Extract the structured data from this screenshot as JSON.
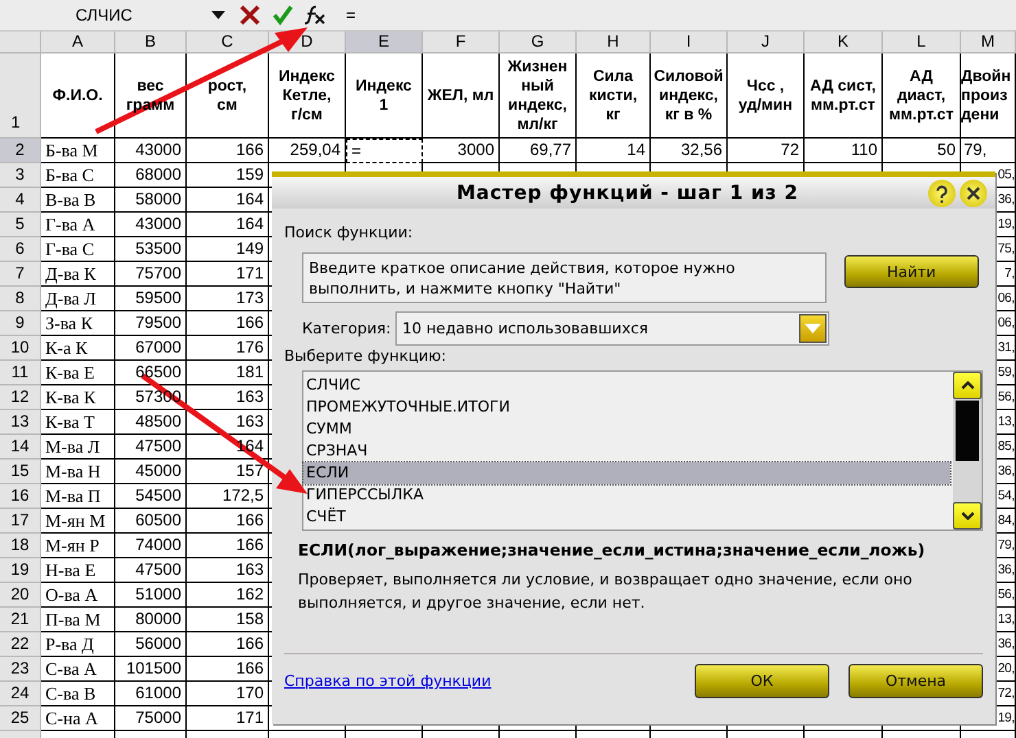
{
  "formula_bar": {
    "name_box": "СЛЧИС",
    "formula": "="
  },
  "sheet": {
    "columns": [
      {
        "letter": "A",
        "kind": "name",
        "selected": false
      },
      {
        "letter": "B",
        "kind": "number",
        "selected": false
      },
      {
        "letter": "C",
        "kind": "number",
        "selected": false
      },
      {
        "letter": "D",
        "kind": "number",
        "selected": false
      },
      {
        "letter": "E",
        "kind": "number",
        "selected": true
      },
      {
        "letter": "F",
        "kind": "number",
        "selected": false
      },
      {
        "letter": "G",
        "kind": "number",
        "selected": false
      },
      {
        "letter": "H",
        "kind": "number",
        "selected": false
      },
      {
        "letter": "I",
        "kind": "number",
        "selected": false
      },
      {
        "letter": "J",
        "kind": "number",
        "selected": false
      },
      {
        "letter": "K",
        "kind": "number",
        "selected": false
      },
      {
        "letter": "L",
        "kind": "number",
        "selected": false
      },
      {
        "letter": "M",
        "kind": "cut",
        "selected": false
      }
    ],
    "header_row": {
      "number": "1",
      "cells": [
        "Ф.И.О.",
        "вес\nграмм",
        "рост,\nсм",
        "Индекс\nКетле,\nг/см",
        "Индекс\n1",
        "ЖЕЛ, мл",
        "Жизнен\nный\nиндекс,\nмл/кг",
        "Сила\nкисти,\nкг",
        "Силовой\nиндекс,\nкг в %",
        "Чсс ,\nуд/мин",
        "АД сист,\nмм.рт.ст",
        "АД\nдиаст,\nмм.рт.ст",
        "Двойн\nпроиз\nдени"
      ]
    },
    "rows": [
      {
        "number": "2",
        "selected": true,
        "cells": [
          "Б-ва М",
          "43000",
          "166",
          "259,04",
          "=",
          "3000",
          "69,77",
          "14",
          "32,56",
          "72",
          "110",
          "50",
          "79,"
        ]
      },
      {
        "number": "3",
        "selected": false,
        "cells": [
          "Б-ва С",
          "68000",
          "159"
        ],
        "column_m": "05,"
      },
      {
        "number": "4",
        "selected": false,
        "cells": [
          "В-ва В",
          "58000",
          "164"
        ],
        "column_m": "36,"
      },
      {
        "number": "5",
        "selected": false,
        "cells": [
          "Г-ва А",
          "43000",
          "164"
        ],
        "column_m": "19,"
      },
      {
        "number": "6",
        "selected": false,
        "cells": [
          "Г-ва С",
          "53500",
          "149"
        ],
        "column_m": "75,"
      },
      {
        "number": "7",
        "selected": false,
        "cells": [
          "Д-ва К",
          "75700",
          "171"
        ],
        "column_m": "7,"
      },
      {
        "number": "8",
        "selected": false,
        "cells": [
          "Д-ва Л",
          "59500",
          "173"
        ],
        "column_m": "06,"
      },
      {
        "number": "9",
        "selected": false,
        "cells": [
          "З-ва К",
          "79500",
          "166"
        ],
        "column_m": "06,"
      },
      {
        "number": "10",
        "selected": false,
        "cells": [
          "К-а К",
          "67000",
          "176"
        ],
        "column_m": "31,"
      },
      {
        "number": "11",
        "selected": false,
        "cells": [
          "К-ва Е",
          "66500",
          "181"
        ],
        "column_m": "59,"
      },
      {
        "number": "12",
        "selected": false,
        "cells": [
          "К-ва К",
          "57300",
          "163"
        ],
        "column_m": "56,"
      },
      {
        "number": "13",
        "selected": false,
        "cells": [
          "К-ва Т",
          "48500",
          "163"
        ],
        "column_m": "13,"
      },
      {
        "number": "14",
        "selected": false,
        "cells": [
          "М-ва Л",
          "47500",
          "164"
        ],
        "column_m": "85,"
      },
      {
        "number": "15",
        "selected": false,
        "cells": [
          "М-ва Н",
          "45000",
          "157"
        ],
        "column_m": "36,"
      },
      {
        "number": "16",
        "selected": false,
        "cells": [
          "М-ва П",
          "54500",
          "172,5"
        ],
        "column_m": "54,"
      },
      {
        "number": "17",
        "selected": false,
        "cells": [
          "М-ян М",
          "60500",
          "166"
        ],
        "column_m": "84,"
      },
      {
        "number": "18",
        "selected": false,
        "cells": [
          "М-ян Р",
          "74000",
          "166"
        ],
        "column_m": "79,"
      },
      {
        "number": "19",
        "selected": false,
        "cells": [
          "Н-ва Е",
          "47500",
          "163"
        ],
        "column_m": "36,"
      },
      {
        "number": "20",
        "selected": false,
        "cells": [
          "О-ва А",
          "51000",
          "162"
        ],
        "column_m": "56,"
      },
      {
        "number": "21",
        "selected": false,
        "cells": [
          "П-ва М",
          "80000",
          "158"
        ],
        "column_m": "13,"
      },
      {
        "number": "22",
        "selected": false,
        "cells": [
          "Р-ва Д",
          "56000",
          "166"
        ],
        "column_m": "36,"
      },
      {
        "number": "23",
        "selected": false,
        "cells": [
          "С-ва А",
          "101500",
          "166"
        ],
        "column_m": "20,"
      },
      {
        "number": "24",
        "selected": false,
        "cells": [
          "С-ва В",
          "61000",
          "170"
        ],
        "column_m": "72,"
      },
      {
        "number": "25",
        "selected": false,
        "cells": [
          "С-на А",
          "75000",
          "171"
        ],
        "column_m": "19,"
      }
    ]
  },
  "dialog": {
    "title": "Мастер функций - шаг 1 из 2",
    "search": {
      "label": "Поиск функции:",
      "value": "Введите краткое описание действия, которое нужно выполнить, и нажмите кнопку \"Найти\""
    },
    "find_button": "Найти",
    "category": {
      "label": "Категория:",
      "value": "10 недавно использовавшихся"
    },
    "list_label": "Выберите функцию:",
    "functions": [
      {
        "name": "СЛЧИС",
        "selected": false
      },
      {
        "name": "ПРОМЕЖУТОЧНЫЕ.ИТОГИ",
        "selected": false
      },
      {
        "name": "СУММ",
        "selected": false
      },
      {
        "name": "СРЗНАЧ",
        "selected": false
      },
      {
        "name": "ЕСЛИ",
        "selected": true
      },
      {
        "name": "ГИПЕРССЫЛКА",
        "selected": false
      },
      {
        "name": "СЧЁТ",
        "selected": false
      }
    ],
    "signature": "ЕСЛИ(лог_выражение;значение_если_истина;значение_если_ложь)",
    "description": "Проверяет, выполняется ли условие, и возвращает одно значение, если оно выполняется, и другое значение, если нет.",
    "help_link": "Справка по этой функции",
    "buttons": [
      "ОК",
      "Отмена"
    ]
  }
}
